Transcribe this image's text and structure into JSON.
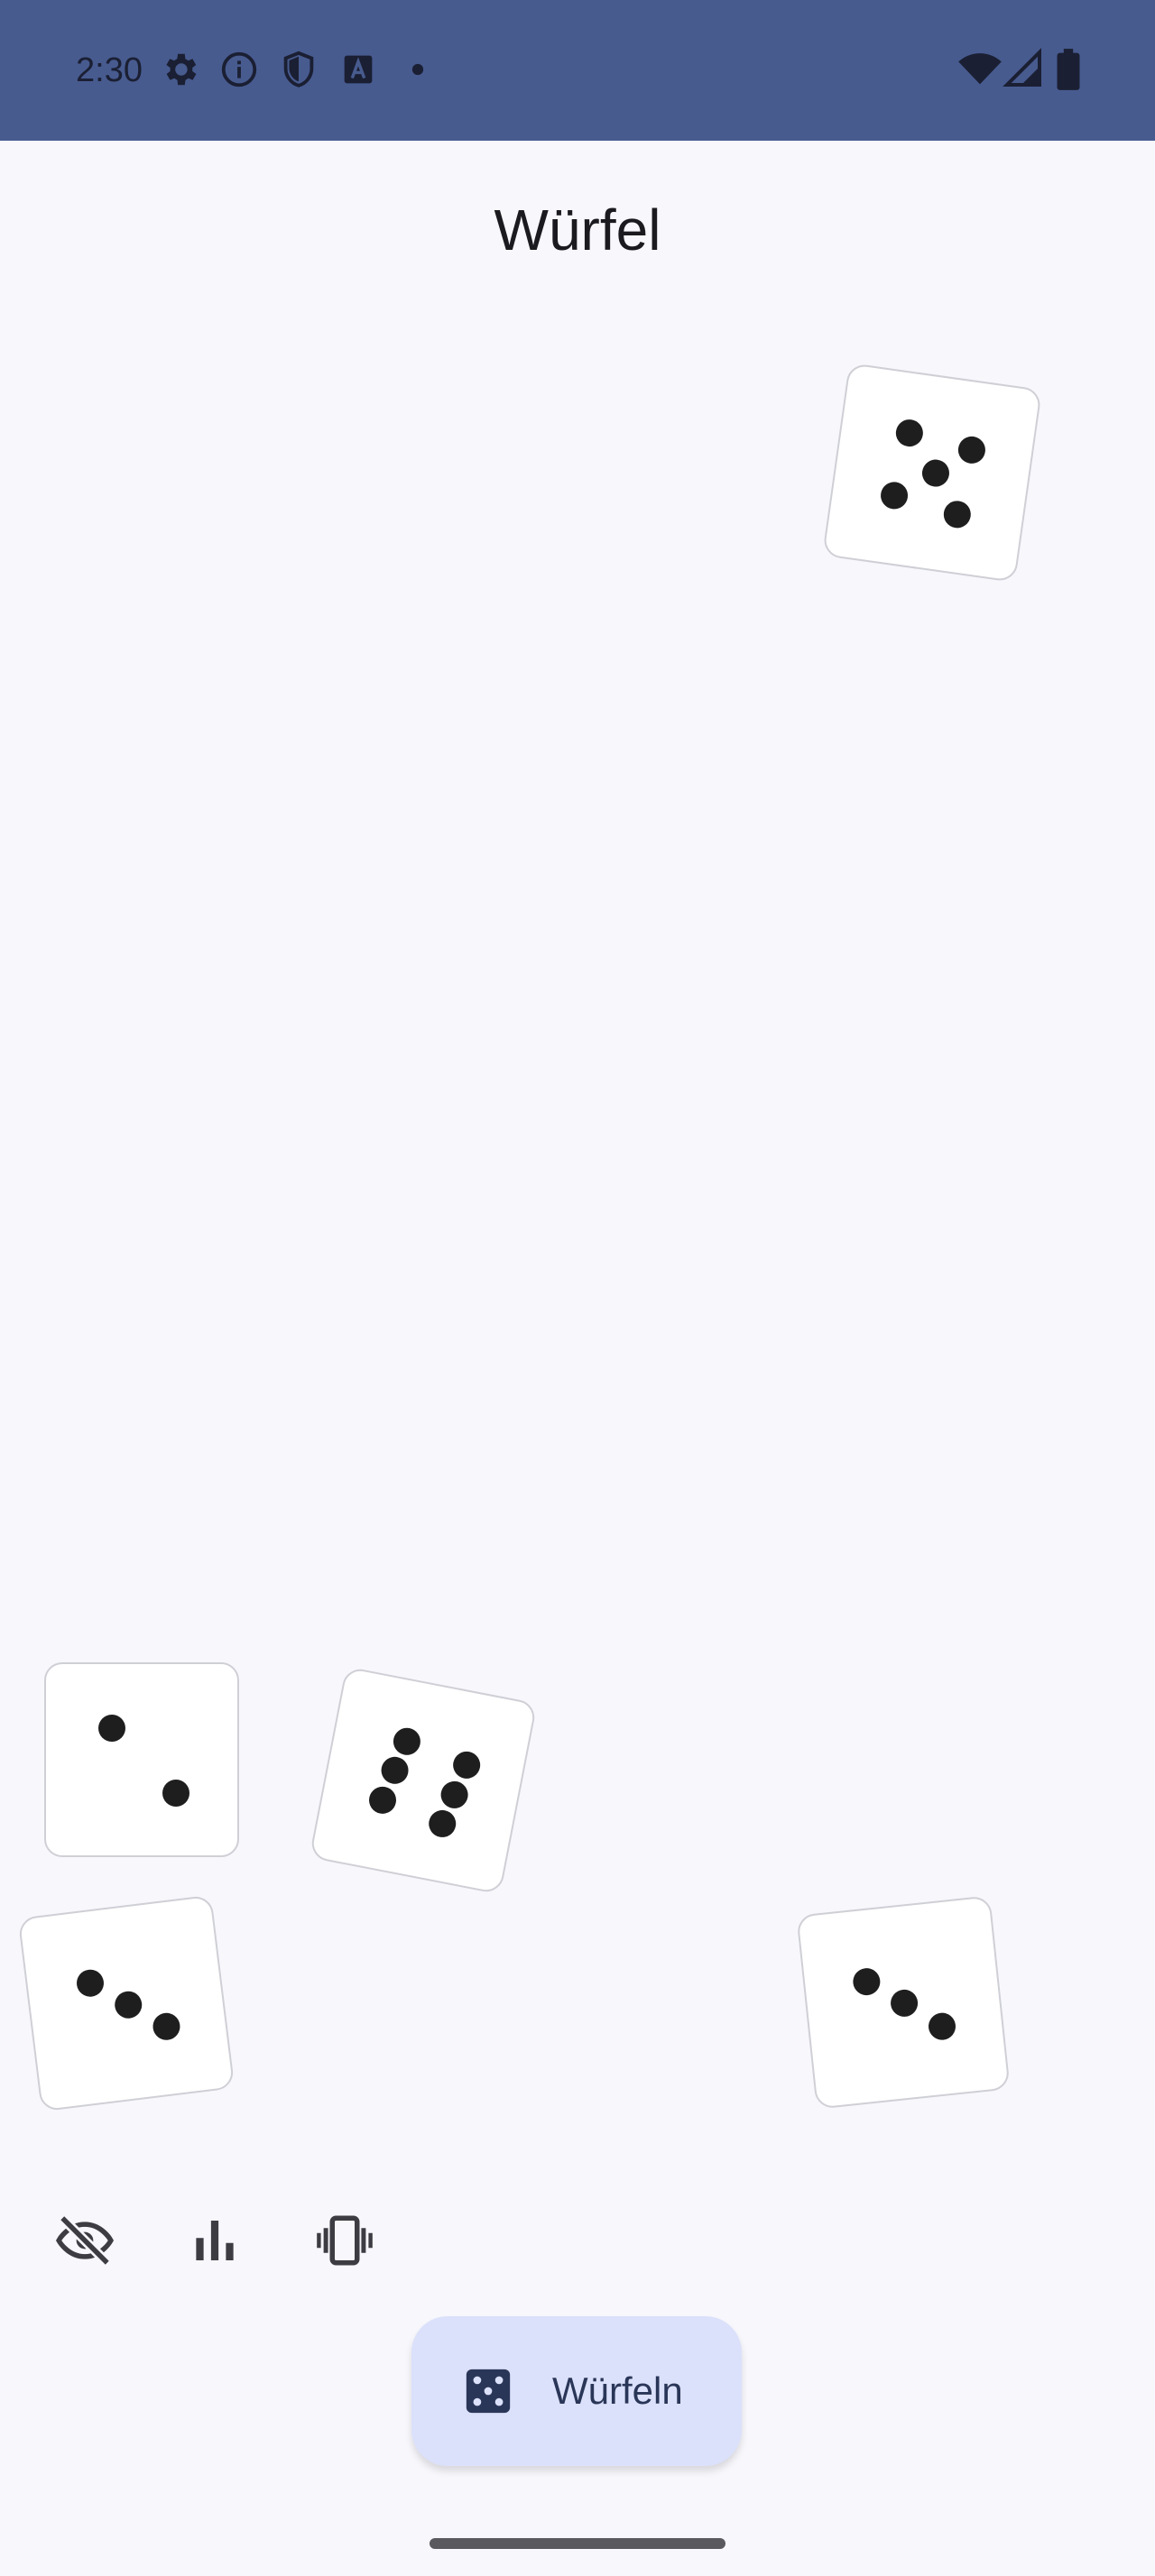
{
  "status_bar": {
    "time": "2:30",
    "left_icons": [
      "gear-icon",
      "info-icon",
      "shield-icon",
      "text-a-icon",
      "dot-icon"
    ],
    "right_icons": [
      "wifi-icon",
      "signal-icon",
      "battery-icon"
    ]
  },
  "app": {
    "title": "Würfel"
  },
  "dice": [
    {
      "value": 5
    },
    {
      "value": 2
    },
    {
      "value": 6
    },
    {
      "value": 3
    },
    {
      "value": 3
    }
  ],
  "toolbar": {
    "items": [
      "visibility-off-icon",
      "bar-chart-icon",
      "vibration-icon"
    ]
  },
  "roll_button": {
    "icon": "dice-icon",
    "label": "Würfeln"
  },
  "colors": {
    "status_bar": "#475b8f",
    "background": "#f7f7fc",
    "fab": "#dbe1fa",
    "fab_text": "#2a3658"
  }
}
